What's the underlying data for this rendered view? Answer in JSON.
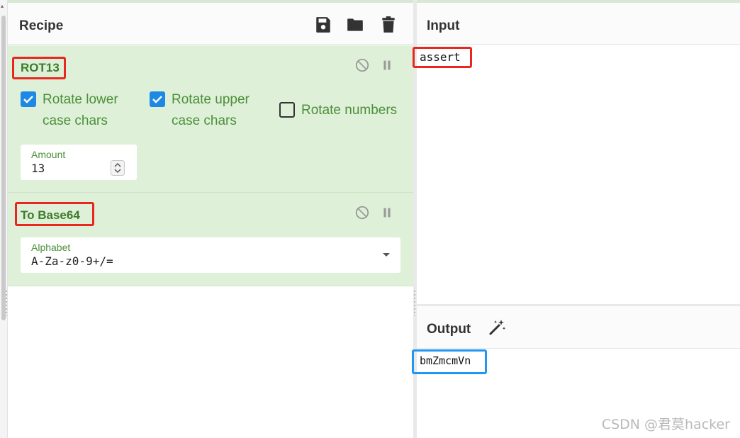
{
  "recipe": {
    "title": "Recipe",
    "toolbar": {
      "save_icon": "save-icon",
      "load_icon": "folder-icon",
      "clear_icon": "trash-icon"
    },
    "operations": [
      {
        "name": "ROT13",
        "options": [
          {
            "label": "Rotate lower\ncase chars",
            "checked": true
          },
          {
            "label": "Rotate upper\ncase chars",
            "checked": true
          },
          {
            "label": "Rotate numbers",
            "checked": false
          }
        ],
        "amount": {
          "label": "Amount",
          "value": "13"
        }
      },
      {
        "name": "To Base64",
        "alphabet": {
          "label": "Alphabet",
          "value": "A-Za-z0-9+/="
        }
      }
    ]
  },
  "input": {
    "title": "Input",
    "value": "assert"
  },
  "output": {
    "title": "Output",
    "value": "bmZmcmVn",
    "magic_icon": "magic-wand-icon"
  },
  "watermark": "CSDN @君莫hacker",
  "colors": {
    "highlight_red": "#e8281f",
    "highlight_blue": "#2196f3",
    "op_bg": "#dff0d8",
    "op_title": "#3c7b2b"
  }
}
